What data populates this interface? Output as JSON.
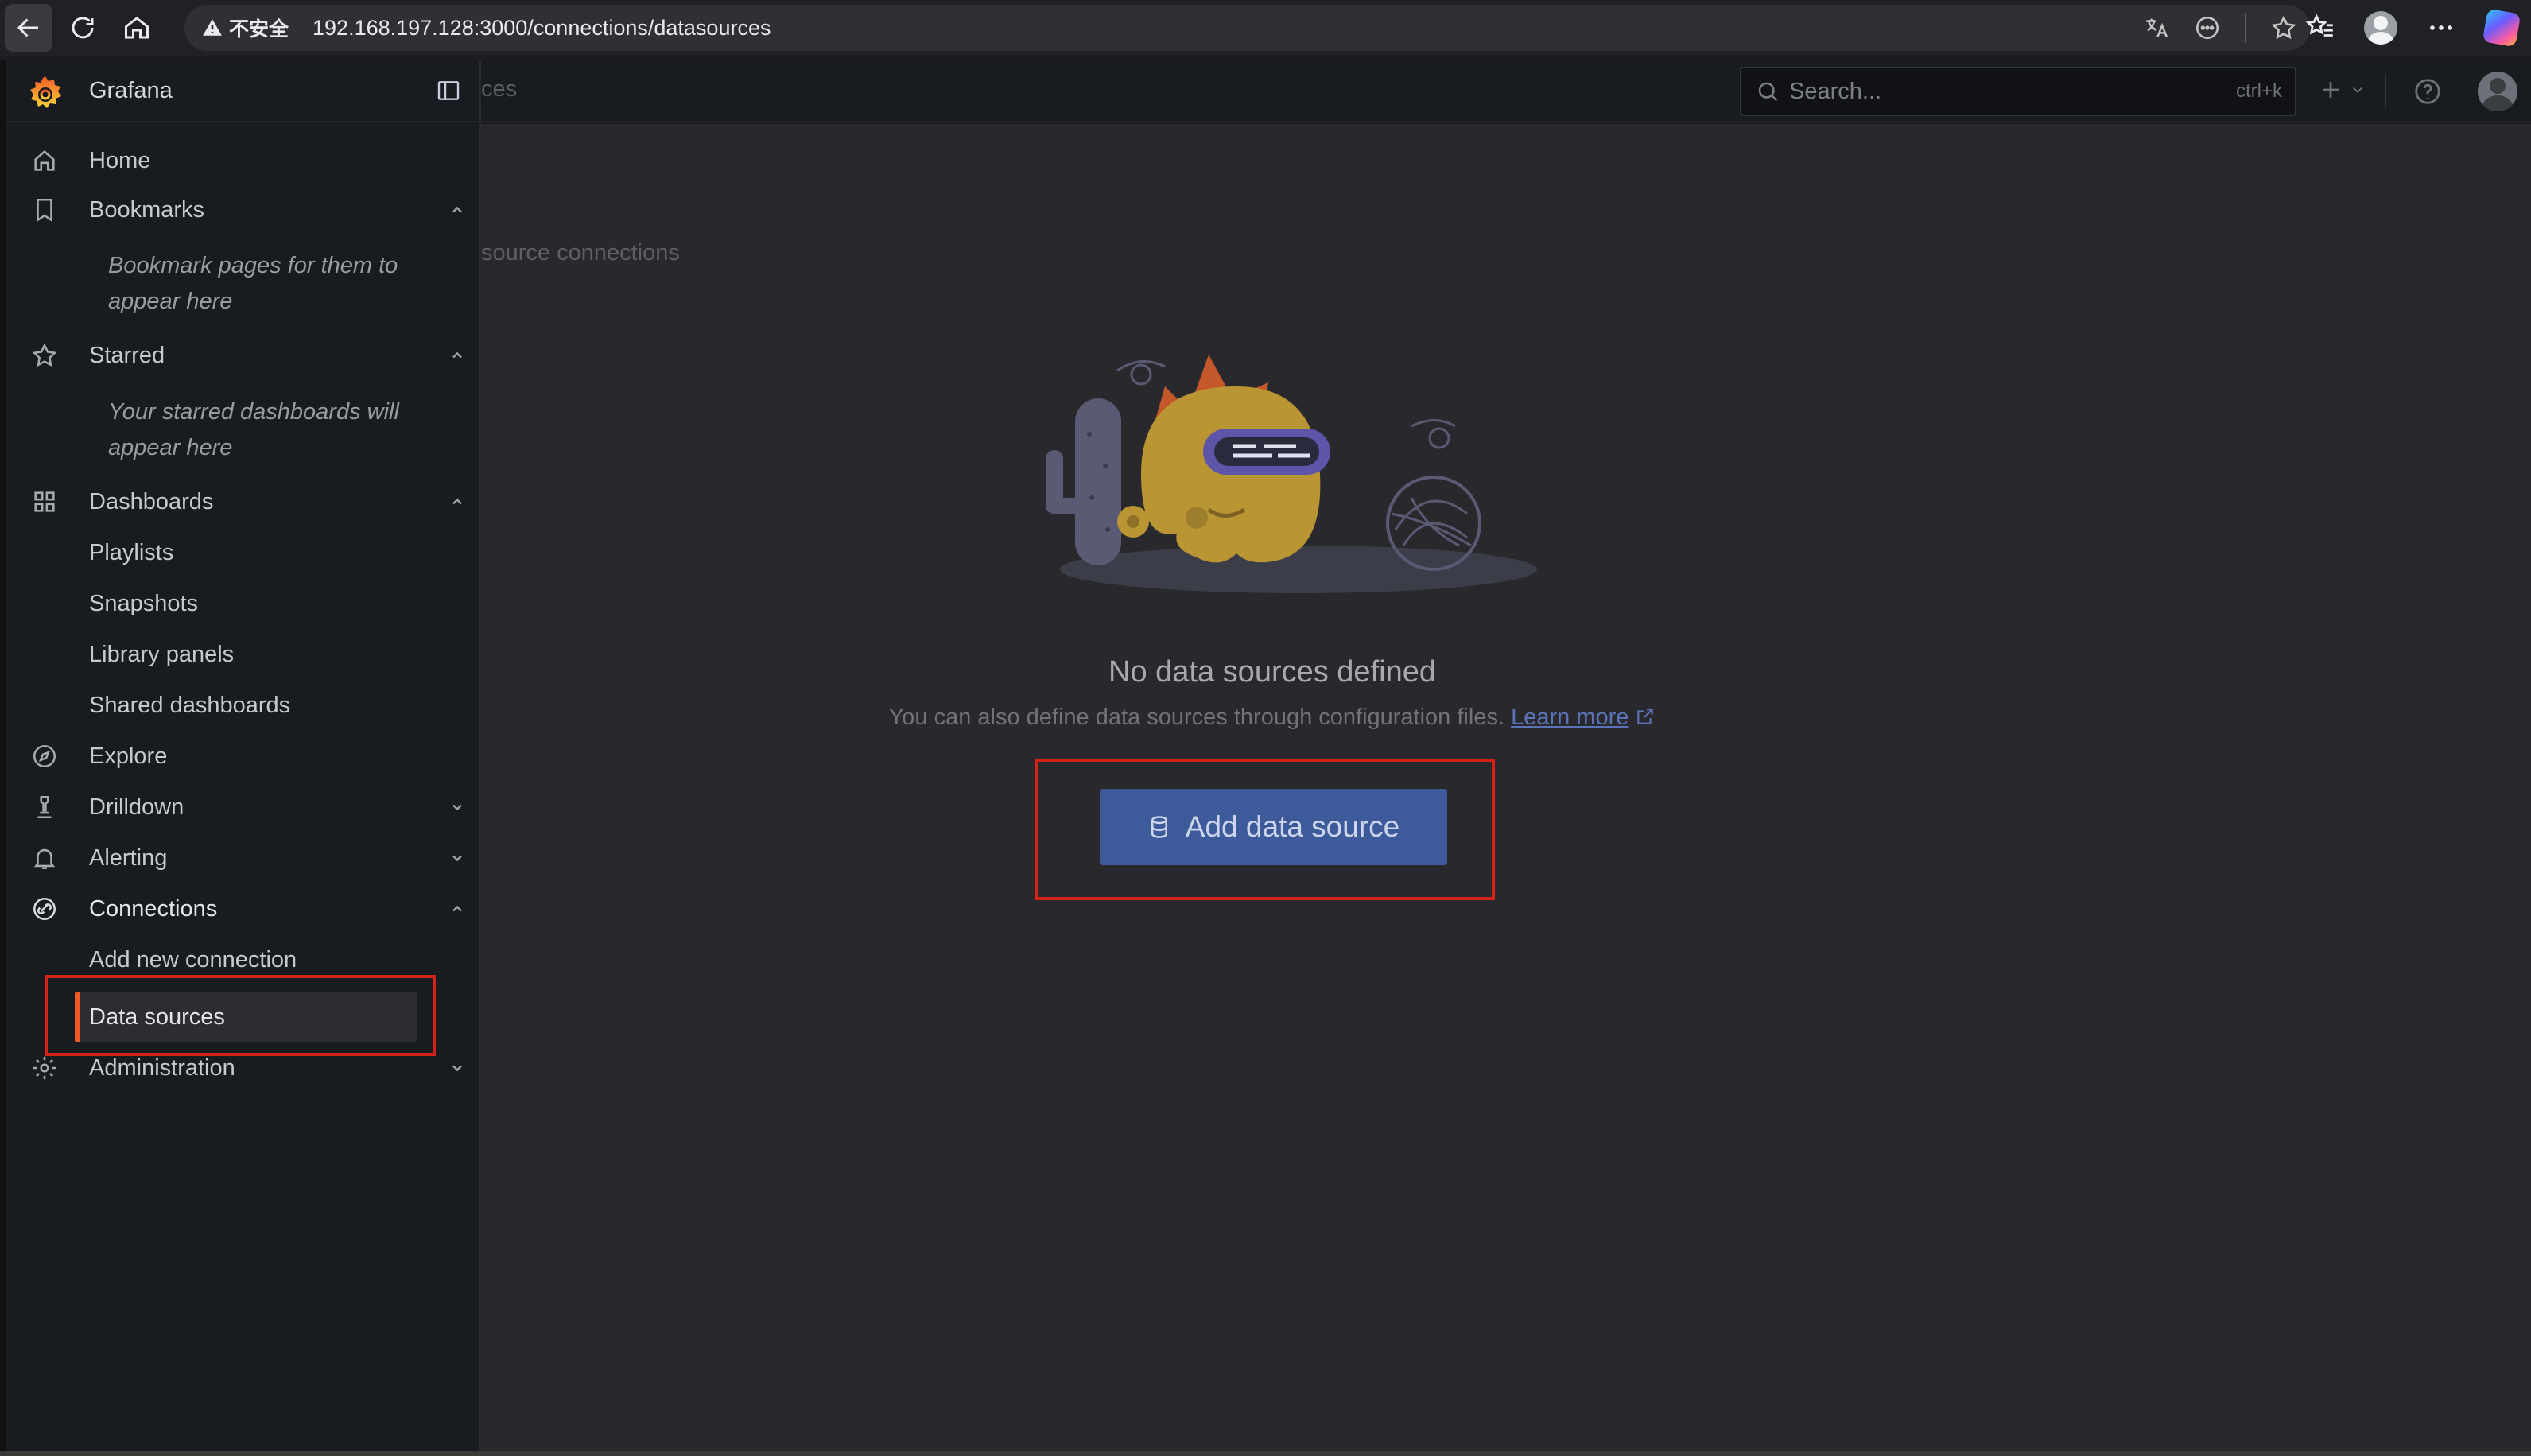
{
  "browser": {
    "security_label": "不安全",
    "url": "192.168.197.128:3000/connections/datasources"
  },
  "topbar": {
    "breadcrumb_partial": "ces",
    "search_placeholder": "Search...",
    "search_shortcut": "ctrl+k"
  },
  "sidebar": {
    "app_name": "Grafana",
    "items": {
      "home": "Home",
      "bookmarks": "Bookmarks",
      "bookmarks_note": "Bookmark pages for them to appear here",
      "starred": "Starred",
      "starred_note": "Your starred dashboards will appear here",
      "dashboards": "Dashboards",
      "playlists": "Playlists",
      "snapshots": "Snapshots",
      "library_panels": "Library panels",
      "shared_dashboards": "Shared dashboards",
      "explore": "Explore",
      "drilldown": "Drilldown",
      "alerting": "Alerting",
      "connections": "Connections",
      "add_new_connection": "Add new connection",
      "data_sources": "Data sources",
      "administration": "Administration"
    }
  },
  "main": {
    "subtitle_partial": "source connections",
    "empty_title": "No data sources defined",
    "empty_desc": "You can also define data sources through configuration files.",
    "learn_more": "Learn more",
    "add_button": "Add data source"
  },
  "colors": {
    "accent_orange": "#f05a28",
    "primary_button": "#3d5a9b",
    "highlight_red": "#d6231a"
  }
}
